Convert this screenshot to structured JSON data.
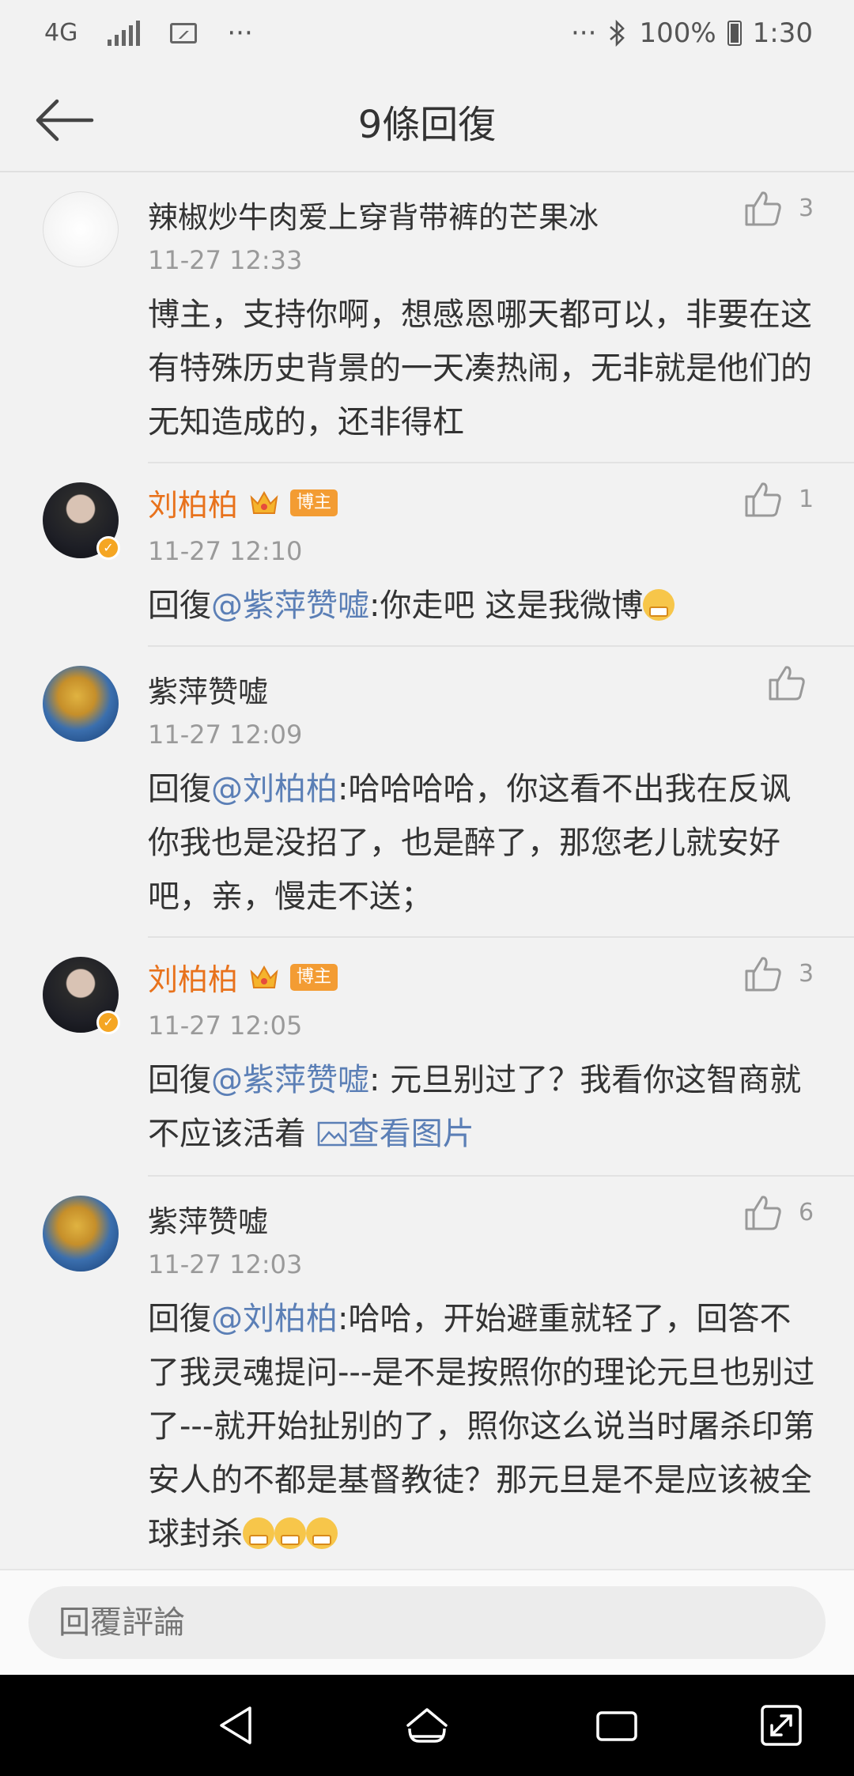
{
  "status_bar": {
    "network": "4G",
    "dots_left": "···",
    "dots_right": "···",
    "battery": "100%",
    "time": "1:30"
  },
  "header": {
    "title": "9條回復"
  },
  "comments": [
    {
      "name": "辣椒炒牛肉爱上穿背带裤的芒果冰",
      "time": "11-27 12:33",
      "likes": "3",
      "text": "博主，支持你啊，想感恩哪天都可以，非要在这有特殊历史背景的一天凑热闹，无非就是他们的无知造成的，还非得杠"
    },
    {
      "name": "刘柏柏",
      "owner_tag": "博主",
      "time": "11-27 12:10",
      "likes": "1",
      "reply_prefix": "回復",
      "mention": "@紫萍赞嘘",
      "text": ":你走吧 这是我微博"
    },
    {
      "name": "紫萍赞嘘",
      "time": "11-27 12:09",
      "likes": "",
      "reply_prefix": "回復",
      "mention": "@刘柏柏",
      "text": ":哈哈哈哈，你这看不出我在反讽你我也是没招了，也是醉了，那您老儿就安好吧，亲，慢走不送；"
    },
    {
      "name": "刘柏柏",
      "owner_tag": "博主",
      "time": "11-27 12:05",
      "likes": "3",
      "reply_prefix": "回復",
      "mention": "@紫萍赞嘘",
      "text": ": 元旦别过了？我看你这智商就不应该活着 ",
      "pic_link": "查看图片"
    },
    {
      "name": "紫萍赞嘘",
      "time": "11-27 12:03",
      "likes": "6",
      "reply_prefix": "回復",
      "mention": "@刘柏柏",
      "text": ":哈哈，开始避重就轻了，回答不了我灵魂提问---是不是按照你的理论元旦也别过了---就开始扯别的了，照你这么说当时屠杀印第安人的不都是基督教徒？那元旦是不是应该被全球封杀"
    }
  ],
  "reply_bar": {
    "placeholder": "回覆評論"
  },
  "colors": {
    "owner_name": "#e8721c",
    "mention": "#5b7fb6",
    "owner_tag_bg": "#f39c33"
  }
}
